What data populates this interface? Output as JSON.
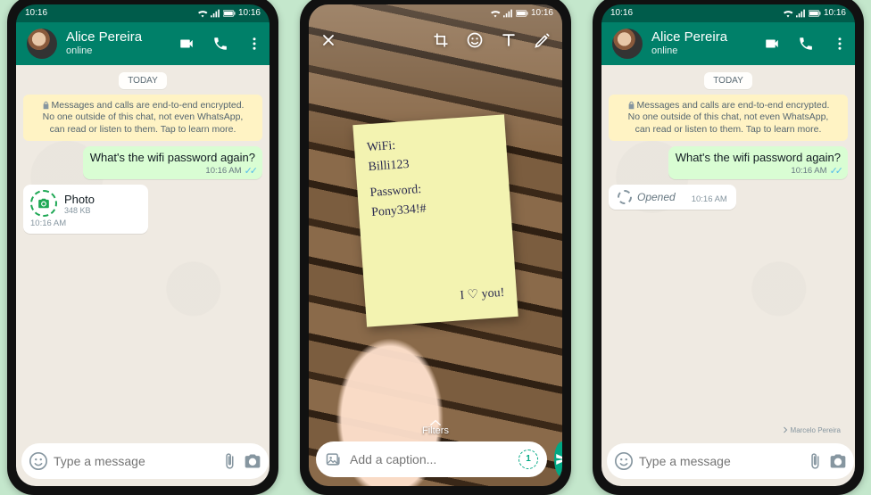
{
  "statusbar": {
    "time": "10:16"
  },
  "contact": {
    "name": "Alice Pereira",
    "status": "online"
  },
  "day_label": "TODAY",
  "encryption_notice": "Messages and calls are end-to-end encrypted. No one outside of this chat, not even WhatsApp, can read or listen to them. Tap to learn more.",
  "outgoing_msg": {
    "text": "What's the wifi password again?",
    "time": "10:16 AM"
  },
  "photo_bubble": {
    "title": "Photo",
    "size": "348 KB",
    "time": "10:16 AM"
  },
  "opened_bubble": {
    "label": "Opened",
    "time": "10:16 AM"
  },
  "composer": {
    "placeholder": "Type a message"
  },
  "disclaimer": "Marcelo Pereira",
  "editor": {
    "note_line1": "WiFi:",
    "note_line2": "Billi123",
    "note_line3": "Password:",
    "note_line4": "Pony334!#",
    "note_love": "I ♡ you!",
    "filters_label": "Filters",
    "caption_placeholder": "Add a caption...",
    "view_once_badge": "1"
  }
}
